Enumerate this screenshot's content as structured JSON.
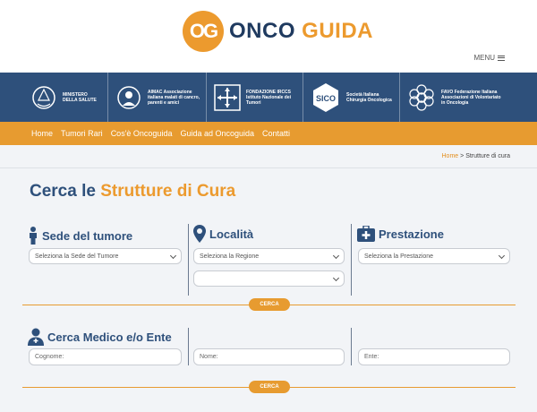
{
  "header": {
    "logo_mark": "OG",
    "brand_first": "ONCO",
    "brand_second": "GUIDA",
    "menu_label": "MENU"
  },
  "partners": [
    {
      "name": "MINISTERO DELLA SALUTE",
      "icon": "ministry-emblem-icon"
    },
    {
      "name": "AIMAC Associazione italiana malati di cancro, parenti e amici",
      "icon": "aimac-icon"
    },
    {
      "name": "FONDAZIONE IRCCS Istituto Nazionale dei Tumori",
      "icon": "int-arrows-icon"
    },
    {
      "name": "Società Italiana Chirurgia Oncologica",
      "icon": "sico-icon",
      "badge": "SICO"
    },
    {
      "name": "FAVO Federazione Italiana Associazioni di Volontariato in Oncologia",
      "icon": "favo-icon"
    }
  ],
  "nav": [
    "Home",
    "Tumori Rari",
    "Cos'è Oncoguida",
    "Guida ad Oncoguida",
    "Contatti"
  ],
  "breadcrumb": {
    "home": "Home",
    "separator": ">",
    "current": "Strutture di cura"
  },
  "title": {
    "prefix": "Cerca le",
    "highlight": "Strutture di Cura"
  },
  "search_structures": {
    "sede": {
      "label": "Sede del tumore",
      "placeholder": "Seleziona la Sede del Tumore"
    },
    "localita": {
      "label": "Località",
      "placeholder": "Seleziona la Regione",
      "second_placeholder": ""
    },
    "prestazione": {
      "label": "Prestazione",
      "placeholder": "Seleziona la Prestazione"
    },
    "button": "CERCA"
  },
  "search_doctor": {
    "label": "Cerca Medico e/o Ente",
    "cognome_placeholder": "Cognome:",
    "nome_placeholder": "Nome:",
    "ente_placeholder": "Ente:",
    "button": "CERCA"
  },
  "colors": {
    "brand_blue": "#2e507b",
    "brand_orange": "#e79b30"
  }
}
